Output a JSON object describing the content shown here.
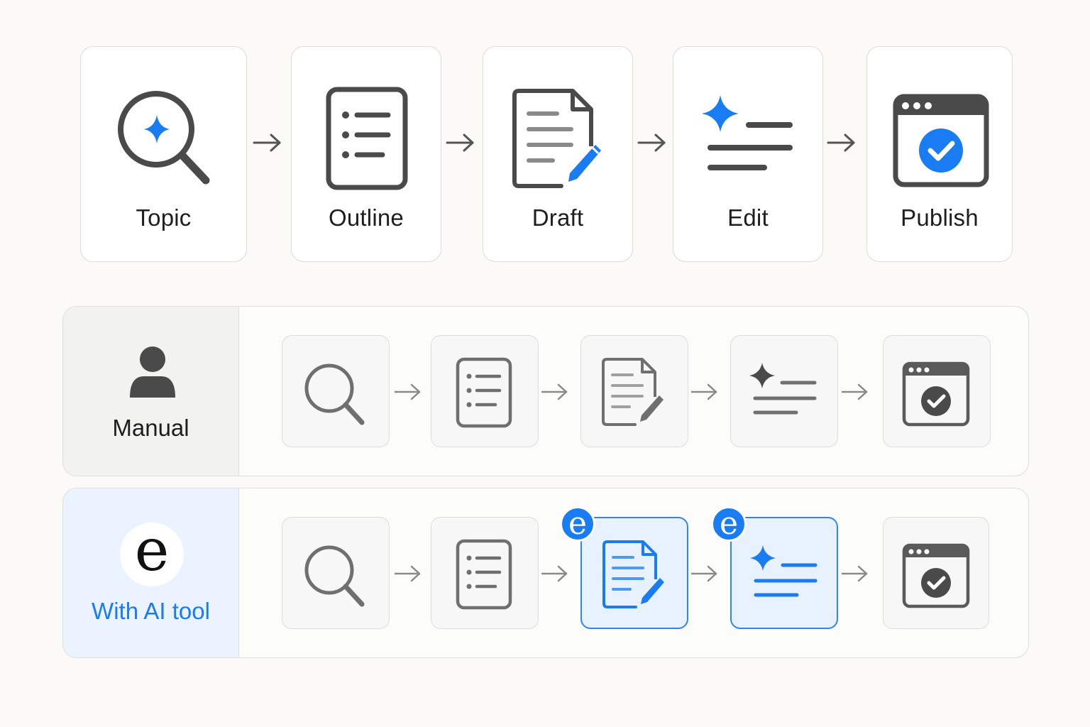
{
  "pipeline": {
    "steps": [
      {
        "label": "Topic",
        "icon": "search-sparkle-icon"
      },
      {
        "label": "Outline",
        "icon": "list-document-icon"
      },
      {
        "label": "Draft",
        "icon": "document-pencil-icon"
      },
      {
        "label": "Edit",
        "icon": "sparkle-lines-icon"
      },
      {
        "label": "Publish",
        "icon": "browser-check-icon"
      }
    ]
  },
  "rows": {
    "manual": {
      "label": "Manual",
      "icon": "person-icon"
    },
    "ai": {
      "label": "With AI tool",
      "icon": "logo-e-icon",
      "logo_letter": "e",
      "badge_letter": "e"
    }
  },
  "colors": {
    "accent": "#1a7cf2",
    "icon_dark": "#4a4a4a",
    "icon_gray": "#6f6f6f",
    "ai_row_bg": "#eaf3ff",
    "manual_row_bg": "#f2f2f0"
  }
}
